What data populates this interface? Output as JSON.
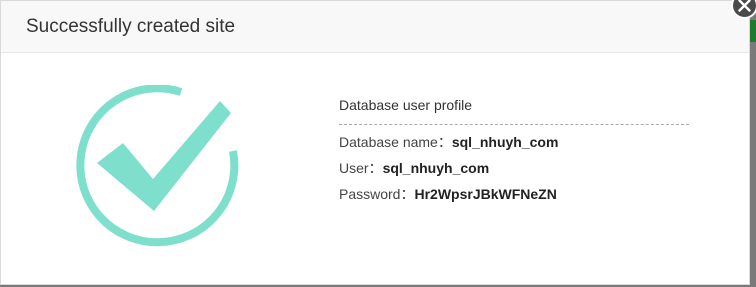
{
  "dialog": {
    "title": "Successfully created site",
    "accent_color": "#7ee0cc"
  },
  "database": {
    "heading": "Database user profile",
    "name_label": "Database name：",
    "name_value": "sql_nhuyh_com",
    "user_label": "User：",
    "user_value": "sql_nhuyh_com",
    "password_label": "Password：",
    "password_value": "Hr2WpsrJBkWFNeZN"
  },
  "icons": {
    "close": "close-icon",
    "success": "checkmark-circle-icon"
  }
}
